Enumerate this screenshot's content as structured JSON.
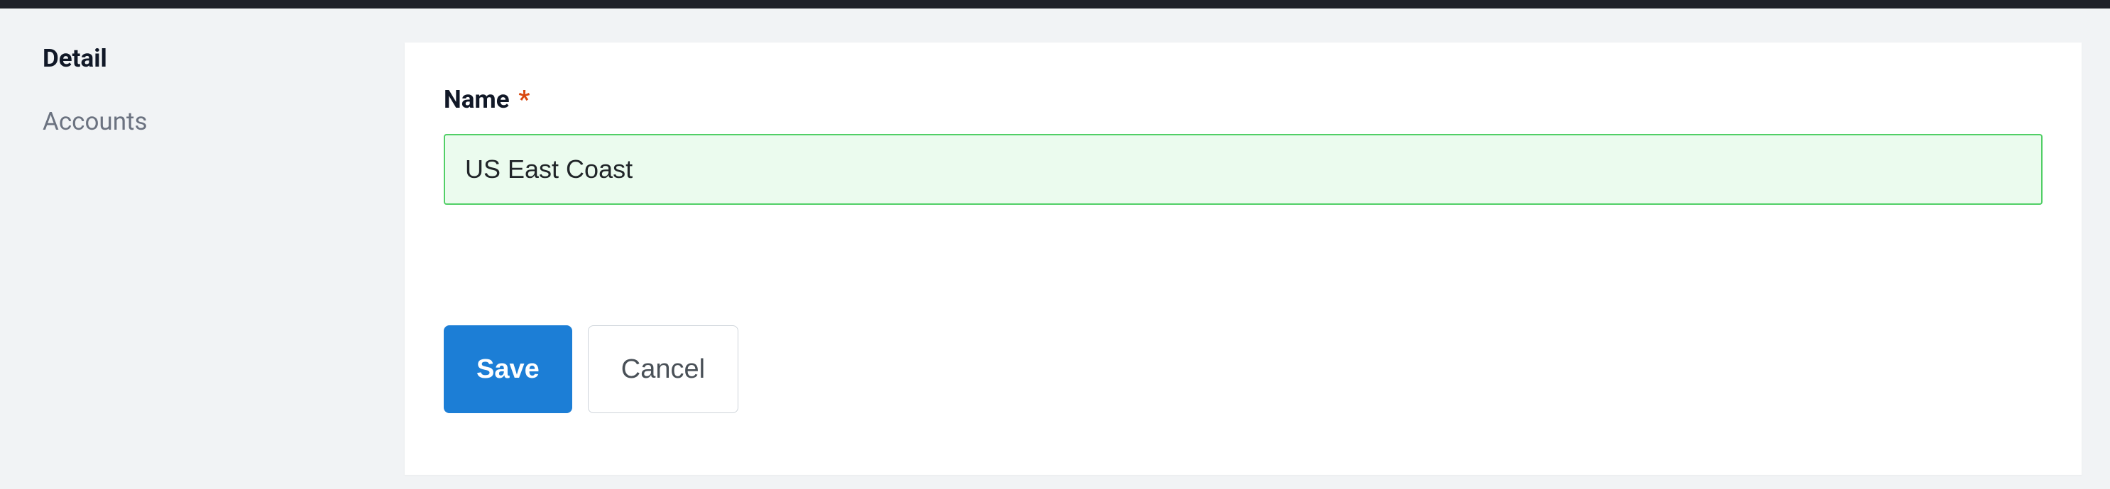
{
  "sidebar": {
    "items": [
      {
        "label": "Detail",
        "active": true
      },
      {
        "label": "Accounts",
        "active": false
      }
    ]
  },
  "form": {
    "name_label": "Name",
    "required_marker": "*",
    "name_value": "US East Coast"
  },
  "actions": {
    "save_label": "Save",
    "cancel_label": "Cancel"
  }
}
